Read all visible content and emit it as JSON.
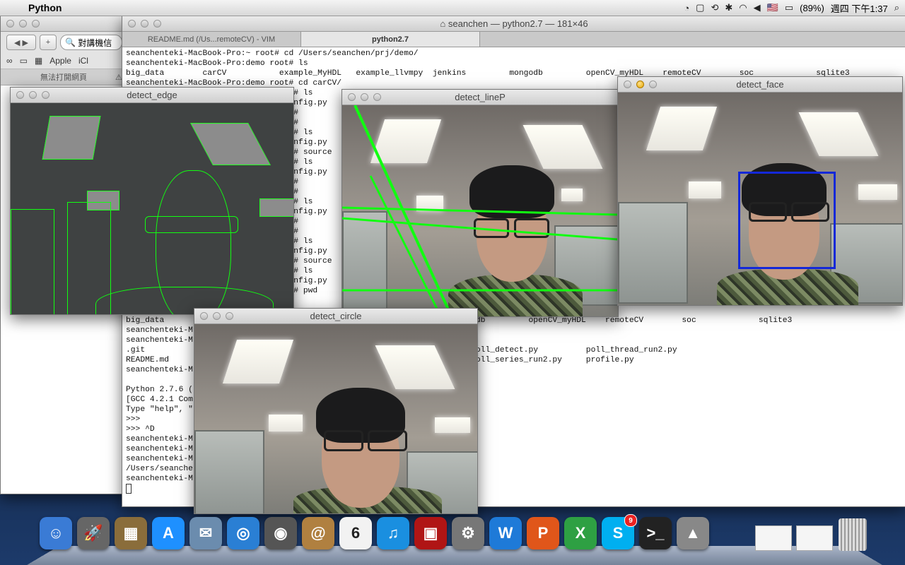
{
  "menubar": {
    "app_name": "Python",
    "input_flag": "🇺🇸",
    "battery": "(89%)",
    "clock": "週四 下午1:37"
  },
  "browser": {
    "search_text": "對講機信",
    "favorites": [
      "Apple",
      "iCl"
    ],
    "tab_label": "無法打開網頁"
  },
  "terminal": {
    "title": "seanchen — python2.7 — 181×46",
    "tabs": [
      "README.md (/Us...remoteCV) - VIM",
      "python2.7"
    ],
    "lines": [
      "seanchenteki-MacBook-Pro:~ root# cd /Users/seanchen/prj/demo/",
      "seanchenteki-MacBook-Pro:demo root# ls",
      "big_data        carCV           example_MyHDL   example_llvmpy  jenkins         mongodb         openCV_myHDL    remoteCV        soc             sqlite3",
      "seanchenteki-MacBook-Pro:demo root# cd carCV/",
      "                                   # ls",
      "                                   nfig.py",
      "                                   #",
      "                                   #",
      "                                   # ls",
      "                                   nfig.py",
      "                                   # source",
      "                                   # ls",
      "                                   nfig.py",
      "                                   #",
      "                                   #",
      "                                   # ls",
      "                                   nfig.py",
      "                                   #",
      "                                   #",
      "                                   # ls",
      "                                   nfig.py",
      "                                   # source",
      "                                   # ls",
      "                                   nfig.py",
      "                                   # pwd",
      "",
      "seancheneki-M",
      "big_data                                                            mongodb         openCV_myHDL    remoteCV        soc             sqlite3",
      "seanchenteki-M",
      "seanchenteki-M",
      ".git                                            poll_camera.py          poll_detect.py          poll_thread_run2.py",
      "README.md                                       poll_camera2.py         poll_series_run2.py     profile.py",
      "seanchenteki-M",
      "",
      "Python 2.7.6 (",
      "[GCC 4.2.1 Com                                                n darwin",
      "Type \"help\", \"",
      ">>>",
      ">>> ^D",
      "seanchenteki-M",
      "seanchenteki-M",
      "seanchenteki-M",
      "/Users/seanche",
      "seanchenteki-M"
    ]
  },
  "windows": {
    "edge": {
      "title": "detect_edge"
    },
    "lineP": {
      "title": "detect_lineP"
    },
    "face": {
      "title": "detect_face"
    },
    "circle": {
      "title": "detect_circle"
    }
  },
  "dock": {
    "items": [
      {
        "name": "finder-icon",
        "glyph": "☺",
        "color": "#3a7bd5"
      },
      {
        "name": "launchpad-icon",
        "glyph": "🚀",
        "color": "#666"
      },
      {
        "name": "photo-browser-icon",
        "glyph": "▦",
        "color": "#8a6d3b"
      },
      {
        "name": "app-store-icon",
        "glyph": "A",
        "color": "#1e90ff"
      },
      {
        "name": "preview-icon",
        "glyph": "✉",
        "color": "#6b8cae"
      },
      {
        "name": "safari-icon",
        "glyph": "◎",
        "color": "#2a7fd4"
      },
      {
        "name": "facetime-icon",
        "glyph": "◉",
        "color": "#555"
      },
      {
        "name": "address-book-icon",
        "glyph": "@",
        "color": "#b08040"
      },
      {
        "name": "calendar-icon",
        "glyph": "6",
        "color": "#f2f2f2"
      },
      {
        "name": "itunes-icon",
        "glyph": "♫",
        "color": "#1a8fe0"
      },
      {
        "name": "photo-booth-icon",
        "glyph": "▣",
        "color": "#b01515"
      },
      {
        "name": "system-preferences-icon",
        "glyph": "⚙",
        "color": "#777"
      },
      {
        "name": "word-icon",
        "glyph": "W",
        "color": "#1e7ad8"
      },
      {
        "name": "powerpoint-icon",
        "glyph": "P",
        "color": "#e0561a"
      },
      {
        "name": "excel-icon",
        "glyph": "X",
        "color": "#2ea043"
      },
      {
        "name": "skype-icon",
        "glyph": "S",
        "color": "#00aff0",
        "badge": "9"
      },
      {
        "name": "terminal-icon",
        "glyph": ">_",
        "color": "#222"
      },
      {
        "name": "rocket-icon",
        "glyph": "▲",
        "color": "#888"
      }
    ]
  }
}
